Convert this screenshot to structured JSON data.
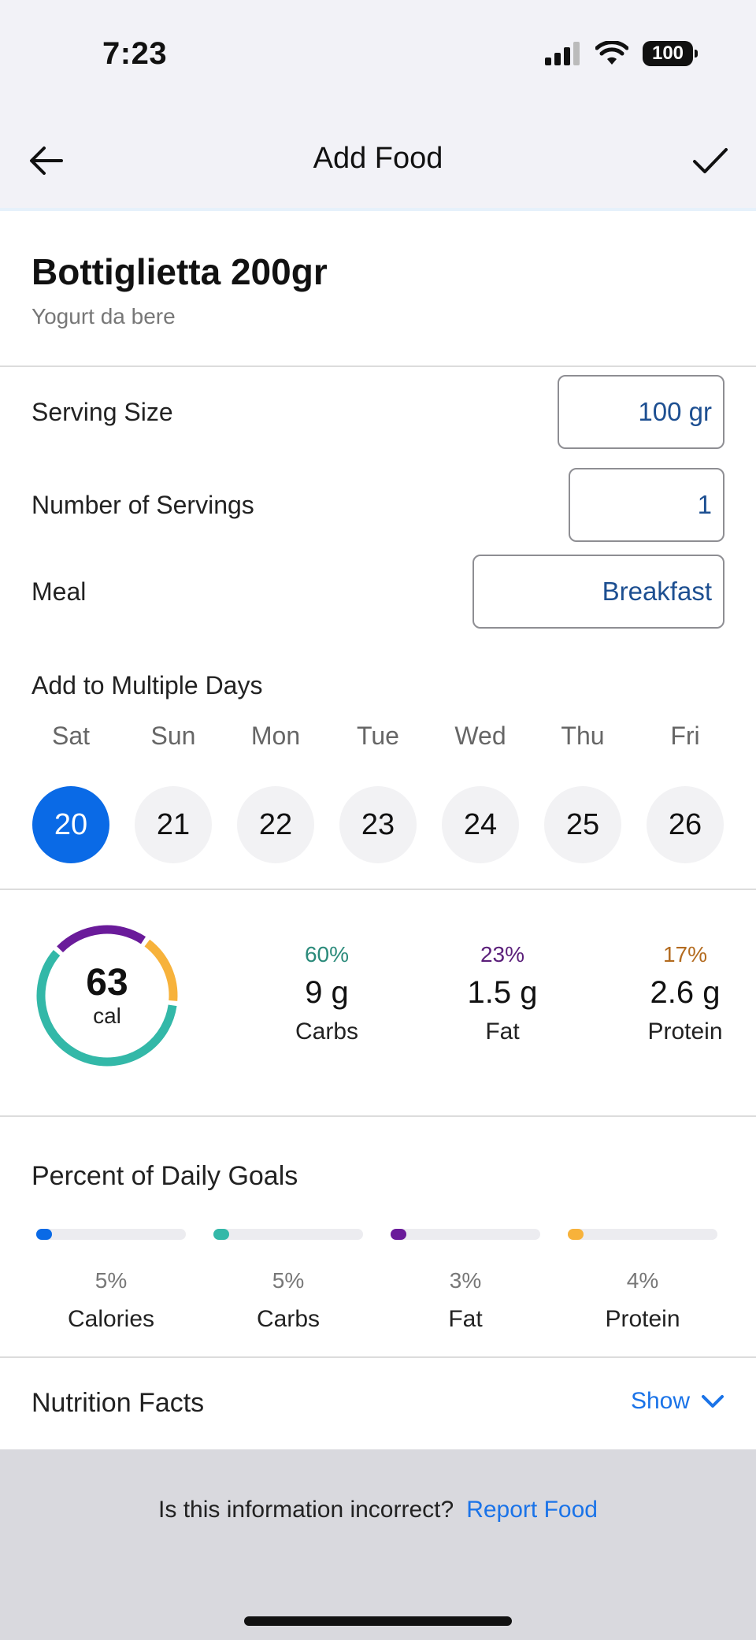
{
  "status": {
    "time": "7:23",
    "battery": "100"
  },
  "nav": {
    "title": "Add Food"
  },
  "food": {
    "name": "Bottiglietta 200gr",
    "description": "Yogurt da bere"
  },
  "form": {
    "serving_size_label": "Serving Size",
    "serving_size_value": "100 gr",
    "servings_label": "Number of Servings",
    "servings_value": "1",
    "meal_label": "Meal",
    "meal_value": "Breakfast"
  },
  "days": {
    "label": "Add to Multiple Days",
    "items": [
      {
        "name": "Sat",
        "date": "20",
        "selected": true
      },
      {
        "name": "Sun",
        "date": "21",
        "selected": false
      },
      {
        "name": "Mon",
        "date": "22",
        "selected": false
      },
      {
        "name": "Tue",
        "date": "23",
        "selected": false
      },
      {
        "name": "Wed",
        "date": "24",
        "selected": false
      },
      {
        "name": "Thu",
        "date": "25",
        "selected": false
      },
      {
        "name": "Fri",
        "date": "26",
        "selected": false
      }
    ]
  },
  "summary": {
    "calories_value": "63",
    "calories_unit": "cal",
    "macros": [
      {
        "pct": "60%",
        "amount": "9 g",
        "name": "Carbs",
        "color": "#2a8a7a",
        "fraction": 0.6,
        "ring_color": "#33b8a8"
      },
      {
        "pct": "23%",
        "amount": "1.5 g",
        "name": "Fat",
        "color": "#5b1f7a",
        "fraction": 0.23,
        "ring_color": "#6a1b9a"
      },
      {
        "pct": "17%",
        "amount": "2.6 g",
        "name": "Protein",
        "color": "#b36b1f",
        "fraction": 0.17,
        "ring_color": "#f7b23b"
      }
    ]
  },
  "goals": {
    "title": "Percent of Daily Goals",
    "items": [
      {
        "pct": "5%",
        "name": "Calories",
        "value": 5,
        "color": "#0a6ae6"
      },
      {
        "pct": "5%",
        "name": "Carbs",
        "value": 5,
        "color": "#33b8a8"
      },
      {
        "pct": "3%",
        "name": "Fat",
        "value": 3,
        "color": "#6a1b9a"
      },
      {
        "pct": "4%",
        "name": "Protein",
        "value": 4,
        "color": "#f7b23b"
      }
    ]
  },
  "nutrition": {
    "label": "Nutrition Facts",
    "toggle": "Show"
  },
  "footer": {
    "question": "Is this information incorrect?",
    "link": "Report Food"
  }
}
